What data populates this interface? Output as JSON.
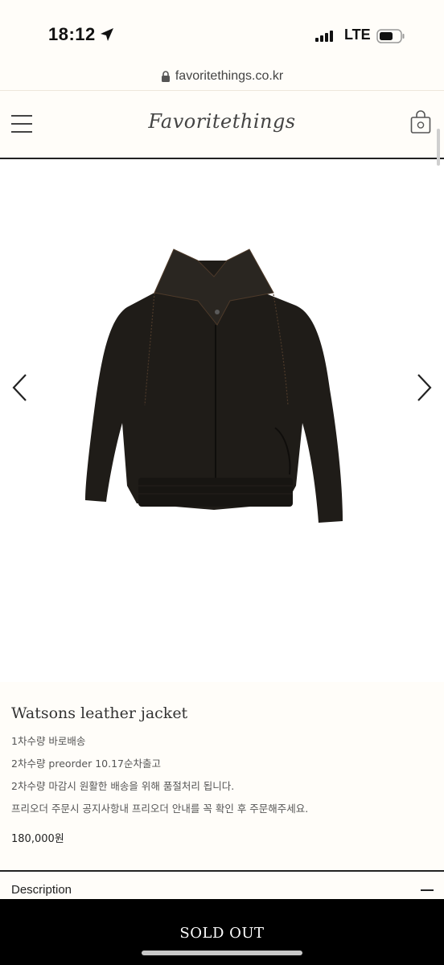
{
  "status": {
    "time": "18:12",
    "network": "LTE"
  },
  "browser": {
    "url": "favoritethings.co.kr"
  },
  "header": {
    "brand": "Favoritethings"
  },
  "product": {
    "name": "Watsons leather jacket",
    "notes": [
      "1차수량 바로배송",
      "2차수량 preorder 10.17순차출고",
      "2차수량 마감시 원활한 배송을 위해 품절처리 됩니다.",
      "프리오더 주문시 공지사항내 프리오더 안내를 꼭 확인 후 주문해주세요."
    ],
    "price": "180,000원"
  },
  "description": {
    "label": "Description"
  },
  "cta": {
    "label": "SOLD OUT"
  },
  "icons": {
    "location": "location-arrow-icon",
    "signal": "cellular-signal-icon",
    "battery": "battery-icon",
    "lock": "lock-icon",
    "menu": "hamburger-menu-icon",
    "bag": "shopping-bag-icon",
    "prev": "chevron-left-icon",
    "next": "chevron-right-icon",
    "collapse": "minus-icon"
  },
  "colors": {
    "background": "#fffdf9",
    "cta": "#000000",
    "text": "#222222"
  }
}
